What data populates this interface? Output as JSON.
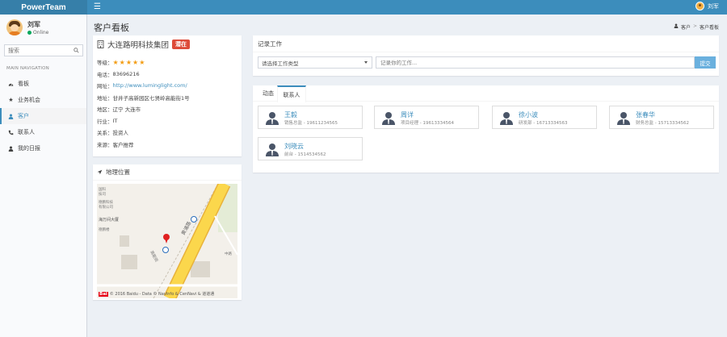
{
  "app": {
    "logo": "PowerTeam"
  },
  "navbar": {
    "user_name": "刘军"
  },
  "sidebar": {
    "user": {
      "name": "刘军",
      "status": "Online"
    },
    "search_placeholder": "搜索",
    "nav_header": "MAIN NAVIGATION",
    "items": [
      {
        "label": "看板",
        "icon": "dashboard-icon",
        "active": false
      },
      {
        "label": "业务机会",
        "icon": "star-icon",
        "active": false
      },
      {
        "label": "客户",
        "icon": "user-icon",
        "active": true
      },
      {
        "label": "联系人",
        "icon": "phone-icon",
        "active": false
      },
      {
        "label": "我的日报",
        "icon": "user-icon",
        "active": false
      }
    ]
  },
  "page": {
    "title": "客户看板"
  },
  "breadcrumb": {
    "items": [
      "客户",
      "客户看板"
    ]
  },
  "company": {
    "name": "大连路明科技集团",
    "status": "潜在",
    "rows": [
      {
        "key": "等级：",
        "value": "★★★★★"
      },
      {
        "key": "电话：",
        "value": "83696216"
      },
      {
        "key": "网址：",
        "value": "http://www.luminglight.com/"
      },
      {
        "key": "地址：",
        "value": "甘井子高新园区七贤岭高能街1号"
      },
      {
        "key": "地区：",
        "value": "辽宁 大连市"
      },
      {
        "key": "行业：",
        "value": "IT"
      },
      {
        "key": "关系：",
        "value": "投资人"
      },
      {
        "key": "来源：",
        "value": "客户推荐"
      }
    ]
  },
  "map": {
    "title": "地理位置",
    "labels": {
      "street1": "黄浦路",
      "street2": "高能街",
      "building": "海万间大厦",
      "misc1": "国科\n技司",
      "misc2": "德鹏科技\n有限公司",
      "misc3": "德鹏楼",
      "misc4": "中路"
    },
    "footer": "© 2016 Baidu - Data © NavInfo & CenNavi & 道道通",
    "logo_text": "Bai"
  },
  "record": {
    "title": "记录工作",
    "type_placeholder": "请选择工作类型",
    "input_placeholder": "记录你的工作...",
    "submit_label": "提交"
  },
  "tabs": {
    "items": [
      "动态",
      "联系人"
    ],
    "active": 1
  },
  "contacts": [
    {
      "name": "王毅",
      "detail": "销售总监 - 19611234565"
    },
    {
      "name": "周详",
      "detail": "项目经理 - 19613334564"
    },
    {
      "name": "徐小波",
      "detail": "研发部 - 16713334563"
    },
    {
      "name": "张春华",
      "detail": "财务总监 - 15713334562"
    },
    {
      "name": "刘晓云",
      "detail": "前台 - 1514534562"
    }
  ],
  "colors": {
    "primary": "#3c8dbc",
    "logo_bg": "#367fa9",
    "danger": "#dd4b39",
    "success": "#00a65a",
    "star": "#f39c12"
  }
}
